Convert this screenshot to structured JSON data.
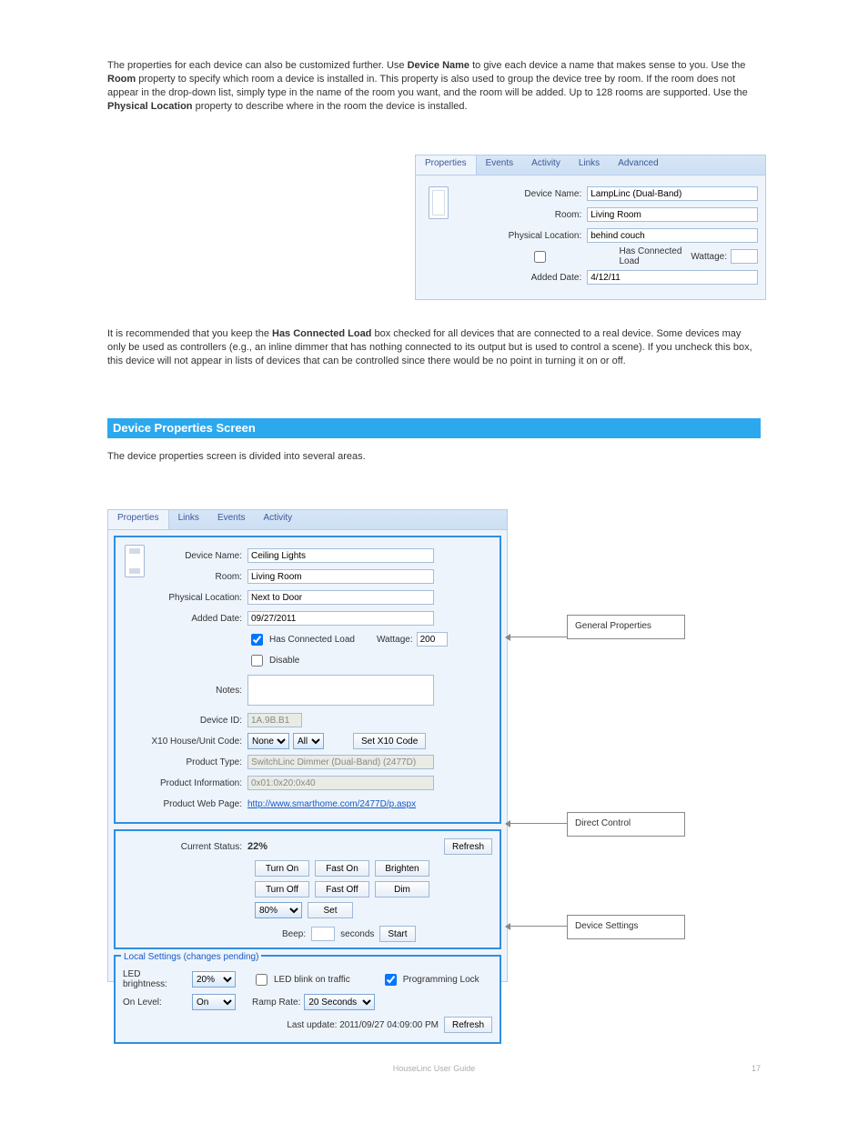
{
  "intro": {
    "p1a": "The properties for each device can also be customized further. Use ",
    "p1b": "Device Name",
    "p1c": " to give each device a name that makes sense to you. Use the ",
    "p1d": "Room",
    "p1e": " property to specify which room a device is installed in. This property is also used to group the device tree by room. If the room does not appear in the drop-down list, simply type in the name of the room you want, and the room will be added. Up to 128 rooms are supported. Use the ",
    "p1f": "Physical Location",
    "p1g": " property to describe where in the room the device is installed."
  },
  "mid": {
    "t1": "It is recommended that you keep the ",
    "t2": "Has Connected Load",
    "t3": " box checked for all devices that are connected to a real device. Some devices may only be used as controllers (e.g., an inline dimmer that has nothing connected to its output but is used to control a scene). If you uncheck this box, this device will not appear in lists of devices that can be controlled since there would be no point in turning it on or off."
  },
  "section_title": "Device Properties Screen",
  "section_desc": "The device properties screen is divided into several areas.",
  "panelTop": {
    "tabs": [
      "Properties",
      "Events",
      "Activity",
      "Links",
      "Advanced"
    ],
    "labels": {
      "name": "Device Name:",
      "room": "Room:",
      "loc": "Physical Location:",
      "added": "Added Date:",
      "hasLoad": "Has Connected Load",
      "watt": "Wattage:"
    },
    "vals": {
      "name": "LampLinc (Dual-Band)",
      "room": "Living Room",
      "loc": "behind couch",
      "added": "4/12/11",
      "watt": ""
    }
  },
  "panelBig": {
    "tabs": [
      "Properties",
      "Links",
      "Events",
      "Activity"
    ],
    "labels": {
      "name": "Device Name:",
      "room": "Room:",
      "loc": "Physical Location:",
      "added": "Added Date:",
      "hasLoad": "Has Connected Load",
      "watt": "Wattage:",
      "disable": "Disable",
      "notes": "Notes:",
      "devid": "Device ID:",
      "x10": "X10 House/Unit Code:",
      "setx10": "Set X10 Code",
      "ptype": "Product Type:",
      "pinfo": "Product Information:",
      "pweb": "Product Web Page:",
      "status": "Current Status:",
      "refresh": "Refresh",
      "turnon": "Turn On",
      "faston": "Fast On",
      "brighten": "Brighten",
      "turnoff": "Turn Off",
      "fastoff": "Fast Off",
      "dim": "Dim",
      "set": "Set",
      "beep": "Beep:",
      "seconds": "seconds",
      "start": "Start",
      "local": "Local Settings (changes pending)",
      "ledb": "LED brightness:",
      "blink": "LED blink on traffic",
      "plock": "Programming Lock",
      "onlevel": "On Level:",
      "ramp": "Ramp Rate:",
      "lastup": "Last update: "
    },
    "vals": {
      "name": "Ceiling Lights",
      "room": "Living Room",
      "loc": "Next to Door",
      "added": "09/27/2011",
      "watt": "200",
      "devid": "1A.9B.B1",
      "x10house": "None",
      "x10unit": "All",
      "ptype": "SwitchLinc Dimmer (Dual-Band) (2477D)",
      "pinfo": "0x01:0x20:0x40",
      "pweb": "http://www.smarthome.com/2477D/p.aspx",
      "status": "22%",
      "setlevel": "80%",
      "beepsec": "",
      "ledb": "20%",
      "onlevel": "On",
      "ramp": "20 Seconds",
      "lastup": "2011/09/27 04:09:00 PM"
    }
  },
  "callouts": {
    "c1": "General Properties",
    "c2": "Direct Control",
    "c3": "Device Settings"
  },
  "footer": {
    "left": "HouseLinc User Guide",
    "page": "17"
  }
}
